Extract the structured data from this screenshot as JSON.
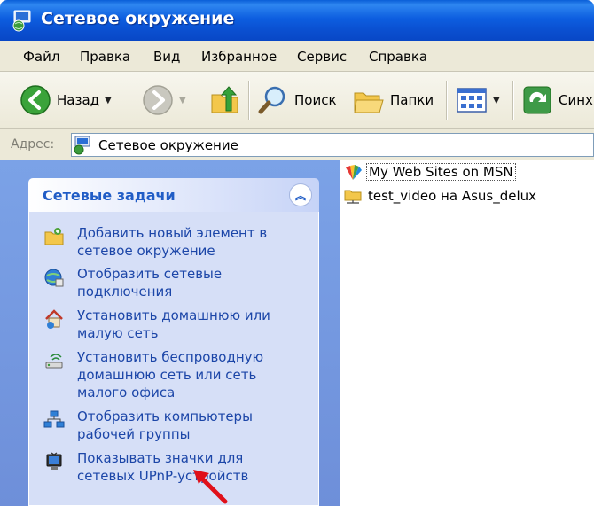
{
  "window": {
    "title": "Сетевое окружение"
  },
  "menu": [
    {
      "label": "Файл"
    },
    {
      "label": "Правка"
    },
    {
      "label": "Вид"
    },
    {
      "label": "Избранное"
    },
    {
      "label": "Сервис"
    },
    {
      "label": "Справка"
    }
  ],
  "toolbar": {
    "back_label": "Назад",
    "search_label": "Поиск",
    "folders_label": "Папки",
    "sync_label": "Синх"
  },
  "address": {
    "label": "Адрес:",
    "value": "Сетевое окружение"
  },
  "tasks_panel": {
    "title": "Сетевые задачи",
    "items": [
      {
        "label": "Добавить новый элемент в сетевое окружение",
        "icon": "add-network-place-icon"
      },
      {
        "label": "Отобразить сетевые подключения",
        "icon": "network-connections-icon"
      },
      {
        "label": "Установить домашнюю или малую сеть",
        "icon": "home-network-icon"
      },
      {
        "label": "Установить беспроводную домашнюю сеть или сеть малого офиса",
        "icon": "wireless-network-icon"
      },
      {
        "label": "Отобразить компьютеры рабочей группы",
        "icon": "workgroup-computers-icon"
      },
      {
        "label": "Показывать значки для сетевых UPnP-устройств",
        "icon": "upnp-device-icon"
      }
    ]
  },
  "files": [
    {
      "label": "My Web Sites on MSN",
      "icon": "msn-icon"
    },
    {
      "label": "test_video на Asus_delux",
      "icon": "network-folder-icon"
    }
  ],
  "colors": {
    "title_bar": "#0a4fd0",
    "task_panel_bg": "#d6dff7",
    "task_link": "#1c46a8",
    "annotation_arrow": "#e0101a"
  }
}
